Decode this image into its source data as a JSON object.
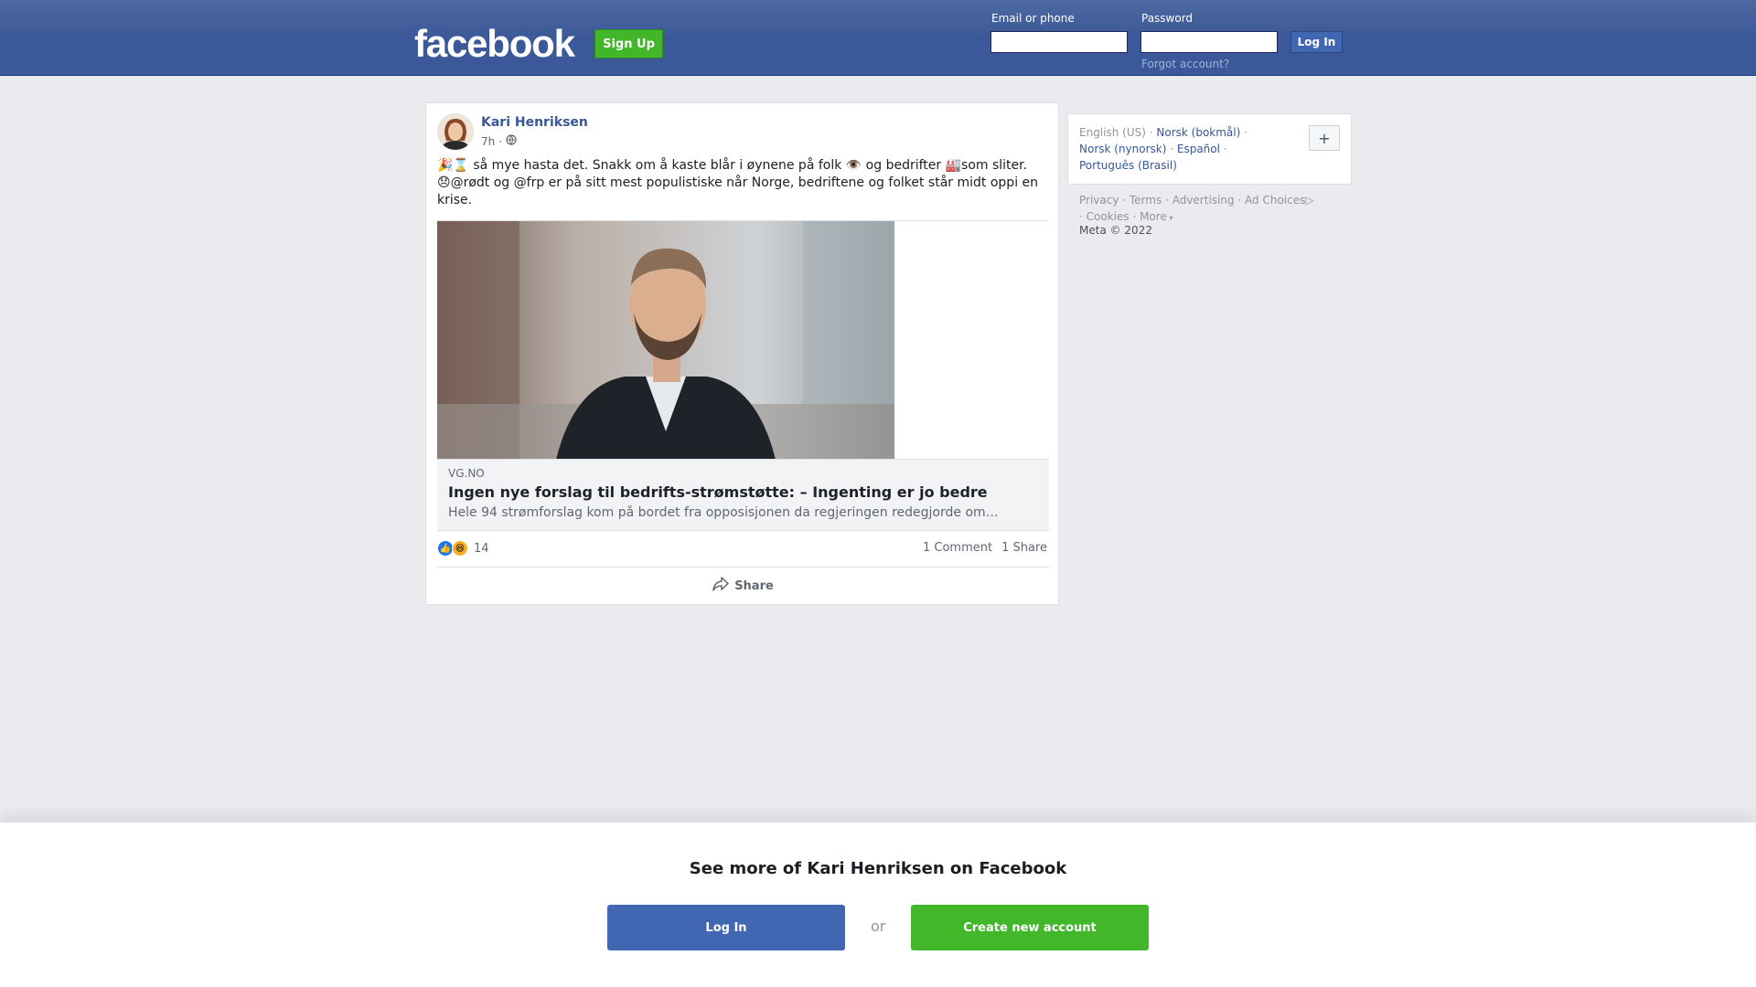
{
  "header": {
    "logo": "facebook",
    "signup_label": "Sign Up",
    "email_label": "Email or phone",
    "password_label": "Password",
    "login_label": "Log In",
    "forgot_label": "Forgot account?"
  },
  "post": {
    "author": "Kari Henriksen",
    "time": "7h",
    "visibility_icon": "globe-icon",
    "text_line1": "🎉⌛ så mye hasta det. Snakk om å kaste blår i øynene på folk 👁️ og bedrifter 🏭som sliter.",
    "text_line2": "😞@rødt og @frp er på sitt mest populistiske når Norge, bedriftene og folket står midt oppi en krise.",
    "link": {
      "domain": "VG.NO",
      "headline": "Ingen nye forslag til bedrifts-strømstøtte: – Ingenting er jo bedre",
      "description": "Hele 94 strømforslag kom på bordet fra opposisjonen da regjeringen redegjorde om…"
    },
    "reaction_count": "14",
    "comments": "1 Comment",
    "shares": "1 Share",
    "share_label": "Share"
  },
  "sidebar": {
    "current_language": "English (US)",
    "languages": [
      "Norsk (bokmål)",
      "Norsk (nynorsk)",
      "Español",
      "Português (Brasil)"
    ],
    "footer_links": [
      "Privacy",
      "Terms",
      "Advertising",
      "Ad Choices",
      "Cookies",
      "More"
    ],
    "copyright": "Meta © 2022"
  },
  "banner": {
    "title": "See more of Kari Henriksen on Facebook",
    "login_label": "Log In",
    "or_label": "or",
    "create_label": "Create new account"
  },
  "colors": {
    "brand_blue": "#3b5998",
    "button_blue": "#4267b2",
    "green": "#42b72a",
    "link_blue": "#385898"
  }
}
